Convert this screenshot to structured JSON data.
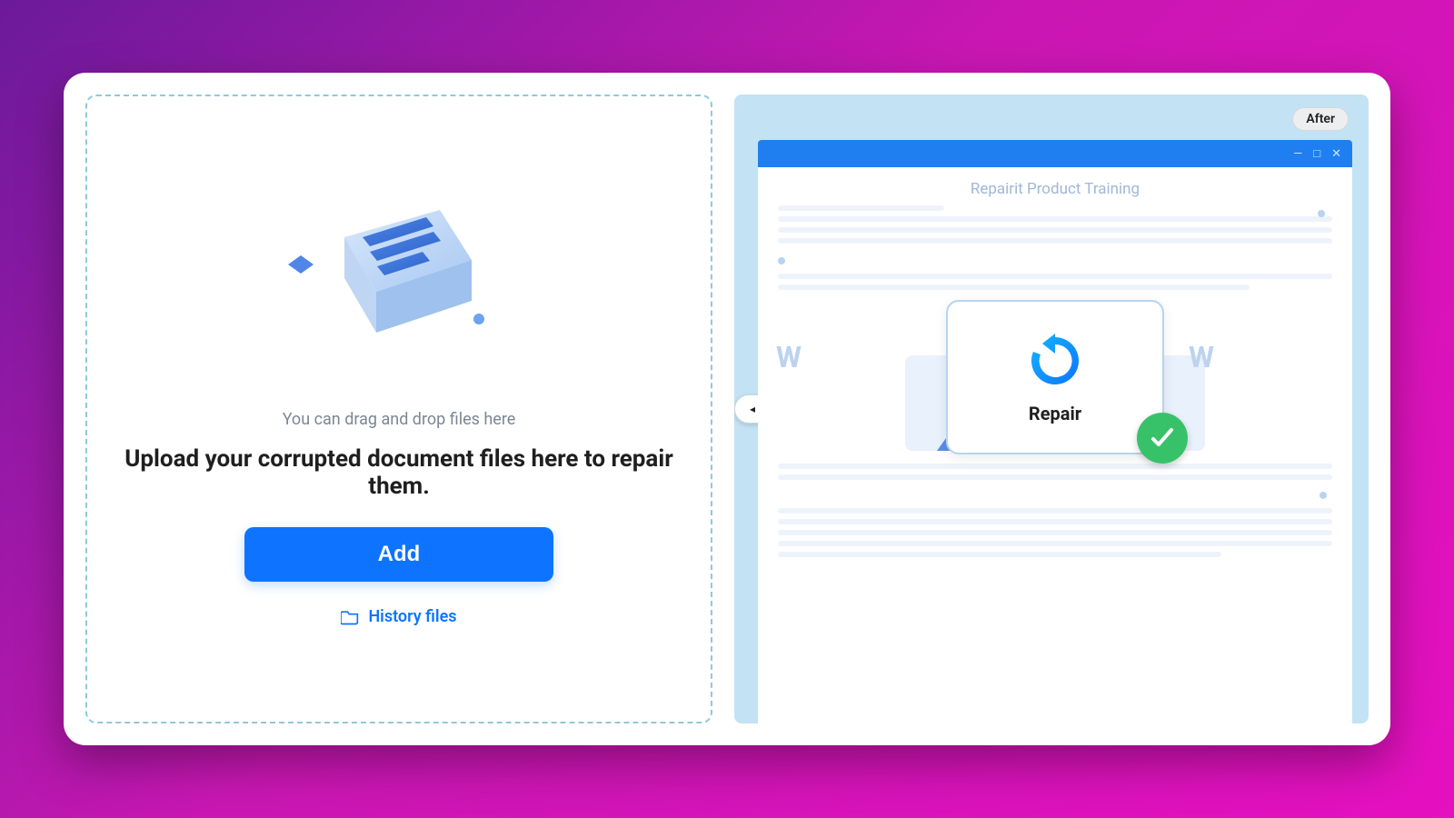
{
  "upload": {
    "hint": "You can drag and drop files here",
    "headline": "Upload your corrupted document files here to repair them.",
    "add_label": "Add",
    "history_label": "History files"
  },
  "preview": {
    "after_label": "After",
    "doc_title": "Repairit Product Training",
    "repair_label": "Repair",
    "window_controls": {
      "min": "—",
      "max": "□",
      "close": "✕"
    },
    "slider": {
      "left": "◂",
      "right": "▸"
    }
  }
}
